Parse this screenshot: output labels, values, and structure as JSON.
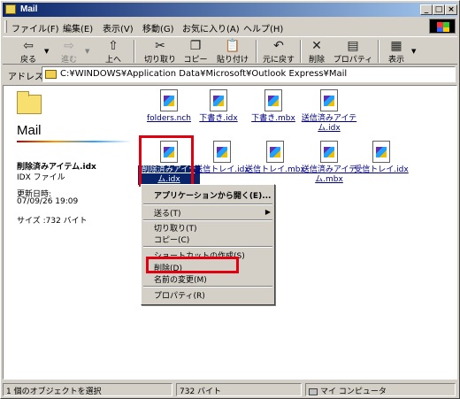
{
  "window": {
    "title": "Mail"
  },
  "menu": {
    "items": [
      "ファイル(F)",
      "編集(E)",
      "表示(V)",
      "移動(G)",
      "お気に入り(A)",
      "ヘルプ(H)"
    ]
  },
  "toolbar": {
    "buttons": [
      {
        "label": "戻る",
        "icon": "back-arrow-icon"
      },
      {
        "label": "進む",
        "icon": "forward-arrow-icon"
      },
      {
        "label": "上へ",
        "icon": "up-folder-icon"
      },
      {
        "label": "切り取り",
        "icon": "scissors-icon"
      },
      {
        "label": "コピー",
        "icon": "copy-icon"
      },
      {
        "label": "貼り付け",
        "icon": "paste-icon"
      },
      {
        "label": "元に戻す",
        "icon": "undo-icon"
      },
      {
        "label": "削除",
        "icon": "delete-x-icon"
      },
      {
        "label": "プロパティ",
        "icon": "properties-icon"
      },
      {
        "label": "表示",
        "icon": "view-icon"
      }
    ]
  },
  "address": {
    "label": "アドレス",
    "path": "C:¥WINDOWS¥Application Data¥Microsoft¥Outlook Express¥Mail"
  },
  "panel": {
    "title": "Mail",
    "file_name": "削除済みアイテム.idx",
    "file_type": "IDX ファイル",
    "modified_label": "更新日時:",
    "modified_value": "07/09/26 19:09",
    "size": "サイズ :732 バイト"
  },
  "files": [
    {
      "name": "folders.nch"
    },
    {
      "name": "下書き.idx"
    },
    {
      "name": "下書き.mbx"
    },
    {
      "name": "送信済みアイテム.idx"
    },
    {
      "name": "削除済みアイテム.idx"
    },
    {
      "name": "送信トレイ.idx"
    },
    {
      "name": "送信トレイ.mbx"
    },
    {
      "name": "送信済みアイテム.mbx"
    },
    {
      "name": "受信トレイ.idx"
    }
  ],
  "context_menu": {
    "items": [
      "アプリケーションから開く(E)...",
      "送る(T)",
      "切り取り(T)",
      "コピー(C)",
      "ショートカットの作成(S)",
      "削除(D)",
      "名前の変更(M)",
      "プロパティ(R)"
    ]
  },
  "status": {
    "selection": "1 個のオブジェクトを選択",
    "size": "732 バイト",
    "zone": "マイ コンピュータ"
  },
  "colors": {
    "highlight": "#e00010",
    "title_bar": "#0a246a"
  }
}
